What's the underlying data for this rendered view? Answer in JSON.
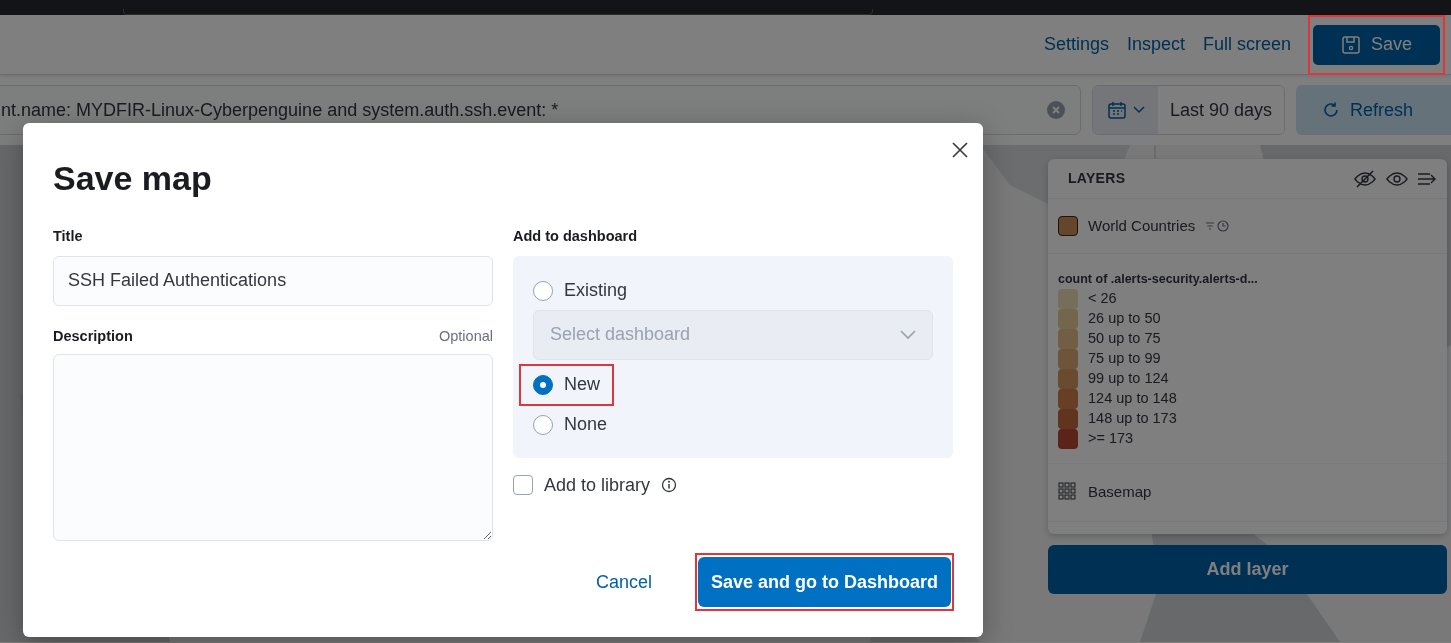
{
  "header": {
    "links": [
      {
        "label": "Settings"
      },
      {
        "label": "Inspect"
      },
      {
        "label": "Full screen"
      }
    ],
    "save_button": {
      "label": "Save",
      "highlighted": true
    }
  },
  "query_bar": {
    "query": "nt.name: MYDFIR-Linux-Cyberpenguine and system.auth.ssh.event: *",
    "date_range": "Last 90 days",
    "refresh_button": "Refresh"
  },
  "layers_panel": {
    "title": "LAYERS",
    "layers": [
      {
        "kind": "vector",
        "name": "World Countries",
        "color": "#65462b"
      },
      {
        "kind": "basemap",
        "name": "Basemap"
      }
    ],
    "legend": {
      "title": "count of .alerts-security.alerts-d...",
      "items": [
        {
          "label": "< 26",
          "color": "#766e5a"
        },
        {
          "label": "26 up to 50",
          "color": "#73664c"
        },
        {
          "label": "50 up to 75",
          "color": "#715e44"
        },
        {
          "label": "75 up to 99",
          "color": "#6e553a"
        },
        {
          "label": "99 up to 124",
          "color": "#6b4b30"
        },
        {
          "label": "124 up to 148",
          "color": "#673f26"
        },
        {
          "label": "148 up to 173",
          "color": "#60341e"
        },
        {
          "label": ">= 173",
          "color": "#5c2318"
        }
      ]
    },
    "add_layer_button": "Add layer"
  },
  "modal": {
    "title": "Save map",
    "title_field": {
      "label": "Title",
      "value": "SSH Failed Authentications"
    },
    "description_field": {
      "label": "Description",
      "hint": "Optional"
    },
    "dashboard": {
      "label": "Add to dashboard",
      "options": [
        {
          "label": "Existing",
          "selected": false,
          "highlighted": false
        },
        {
          "label": "New",
          "selected": true,
          "highlighted": true
        },
        {
          "label": "None",
          "selected": false,
          "highlighted": false
        }
      ],
      "select_placeholder": "Select dashboard"
    },
    "library_checkbox": {
      "label": "Add to library",
      "checked": false
    },
    "cancel_button": "Cancel",
    "confirm_button": {
      "label": "Save and go to Dashboard",
      "highlighted": true
    }
  }
}
